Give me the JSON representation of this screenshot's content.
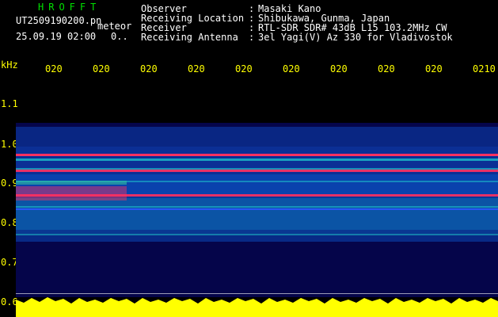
{
  "brand": "HROFFT",
  "file_name": "UT2509190200.pn",
  "meteor_label": "meteor",
  "datetime": "25.09.19 02:00",
  "count_char": "0..",
  "info": [
    {
      "label": "Observer",
      "value": "Masaki Kano"
    },
    {
      "label": "Receiving Location",
      "value": "Shibukawa, Gunma, Japan"
    },
    {
      "label": "Receiver",
      "value": "RTL-SDR SDR# 43dB L15 103.2MHz CW"
    },
    {
      "label": "Receiving Antenna",
      "value": "3el Yagi(V) Az 330 for Vladivostok"
    }
  ],
  "separator": ":",
  "axis": {
    "y_unit": "kHz",
    "x_ticks": [
      "020",
      "020",
      "020",
      "020",
      "020",
      "020",
      "020",
      "020",
      "020",
      "0210"
    ],
    "y_ticks": [
      "1.1",
      "1.0",
      "0.9",
      "0.8",
      "0.7",
      "0.6"
    ]
  },
  "colors": {
    "background": "#000000",
    "spectrum_bg": "#05054a",
    "axis_text": "#ffff00",
    "brand": "#00e000",
    "signal_strong": "#ff3060",
    "signal_mid": "#20d0d0"
  }
}
